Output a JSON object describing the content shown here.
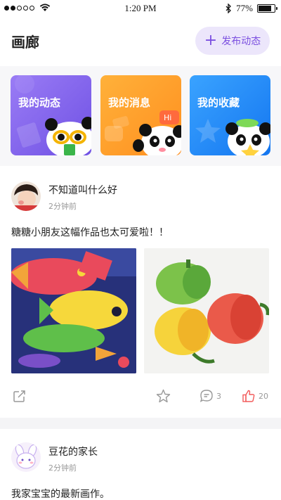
{
  "status_bar": {
    "time": "1:20 PM",
    "battery": "77%",
    "battery_level": 0.77
  },
  "header": {
    "title": "画廊",
    "publish_label": "发布动态"
  },
  "quick_cards": [
    {
      "label": "我的动态"
    },
    {
      "label": "我的消息",
      "badge": "Hi"
    },
    {
      "label": "我的收藏"
    }
  ],
  "posts": [
    {
      "author": "不知道叫什么好",
      "time": "2分钟前",
      "text": "糖糖小朋友这幅作品也太可爱啦！！",
      "comments": "3",
      "likes": "20"
    },
    {
      "author": "豆花的家长",
      "time": "2分钟前",
      "text": "我家宝宝的最新画作。"
    }
  ],
  "colors": {
    "accent": "#7b4fe0",
    "accent_bg": "#ece6fb",
    "like": "#f25a5a"
  }
}
